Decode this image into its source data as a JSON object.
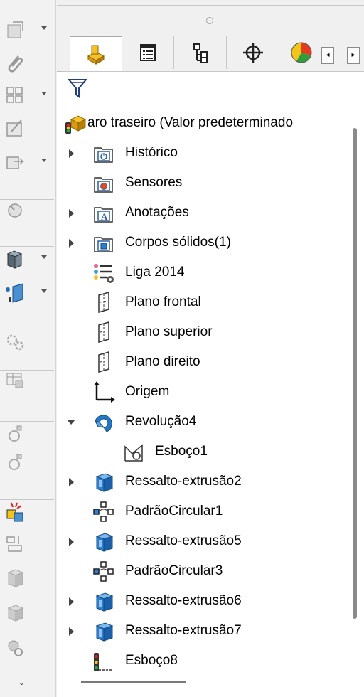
{
  "toolbar": {
    "buttons": [
      {
        "icon": "new-sketch-icon",
        "dropdown": true
      },
      {
        "icon": "paperclip-icon",
        "dropdown": false
      },
      {
        "icon": "grid-layout-icon",
        "dropdown": true
      },
      {
        "icon": "edit-sketch-icon",
        "dropdown": false
      },
      {
        "icon": "relations-icon",
        "dropdown": true
      },
      {
        "icon": "rebuild-icon",
        "dropdown": false
      },
      {
        "icon": "extrude-boss-icon",
        "dropdown": true
      },
      {
        "icon": "reference-plane-icon",
        "dropdown": true
      },
      {
        "icon": "gears-icon",
        "dropdown": false
      },
      {
        "icon": "table-icon",
        "dropdown": false
      },
      {
        "icon": "mate-icon",
        "dropdown": false
      },
      {
        "icon": "mate-alt-icon",
        "dropdown": false
      },
      {
        "icon": "explode-icon",
        "dropdown": false
      },
      {
        "icon": "align-icon",
        "dropdown": false
      },
      {
        "icon": "component-icon",
        "dropdown": false
      },
      {
        "icon": "assembly-icon",
        "dropdown": false
      },
      {
        "icon": "camera-icon",
        "dropdown": false
      }
    ],
    "more_label": "ˇ"
  },
  "tabs": [
    {
      "icon": "feature-manager-icon",
      "active": true
    },
    {
      "icon": "property-manager-icon",
      "active": false
    },
    {
      "icon": "configuration-manager-icon",
      "active": false
    },
    {
      "icon": "dimxpert-icon",
      "active": false
    },
    {
      "icon": "display-manager-icon",
      "active": false
    }
  ],
  "tab_scroll": {
    "left": "◂",
    "right": "▸"
  },
  "filter": {
    "icon": "filter-icon"
  },
  "tree": {
    "root": {
      "label": "aro traseiro  (Valor predeterminado",
      "icon": "part-icon"
    },
    "items": [
      {
        "label": "Histórico",
        "icon": "history-folder-icon",
        "expander": "right",
        "indent": 0
      },
      {
        "label": "Sensores",
        "icon": "sensors-folder-icon",
        "expander": "",
        "indent": 0
      },
      {
        "label": "Anotações",
        "icon": "annotations-folder-icon",
        "expander": "right",
        "indent": 0
      },
      {
        "label": "Corpos sólidos(1)",
        "icon": "solid-bodies-folder-icon",
        "expander": "right",
        "indent": 0
      },
      {
        "label": "Liga 2014",
        "icon": "material-icon",
        "expander": "",
        "indent": 0
      },
      {
        "label": "Plano frontal",
        "icon": "plane-icon",
        "expander": "",
        "indent": 0
      },
      {
        "label": "Plano superior",
        "icon": "plane-icon",
        "expander": "",
        "indent": 0
      },
      {
        "label": "Plano direito",
        "icon": "plane-icon",
        "expander": "",
        "indent": 0
      },
      {
        "label": "Origem",
        "icon": "origin-icon",
        "expander": "",
        "indent": 0
      },
      {
        "label": "Revolução4",
        "icon": "revolve-icon",
        "expander": "down",
        "indent": 0
      },
      {
        "label": "Esboço1",
        "icon": "sketch-icon",
        "expander": "",
        "indent": 1
      },
      {
        "label": "Ressalto-extrusão2",
        "icon": "extrude-icon",
        "expander": "right",
        "indent": 0
      },
      {
        "label": "PadrãoCircular1",
        "icon": "circular-pattern-icon",
        "expander": "",
        "indent": 0
      },
      {
        "label": "Ressalto-extrusão5",
        "icon": "extrude-icon",
        "expander": "right",
        "indent": 0
      },
      {
        "label": "PadrãoCircular3",
        "icon": "circular-pattern-icon",
        "expander": "",
        "indent": 0
      },
      {
        "label": "Ressalto-extrusão6",
        "icon": "extrude-icon",
        "expander": "right",
        "indent": 0
      },
      {
        "label": "Ressalto-extrusão7",
        "icon": "extrude-icon",
        "expander": "right",
        "indent": 0
      },
      {
        "label": "Esboço8",
        "icon": "sketch-3d-icon",
        "expander": "",
        "indent": 0
      }
    ]
  },
  "colors": {
    "accent": "#1e6fb8",
    "folder_blue": "#2a5fa0",
    "extrude_blue": "#1c6aa8"
  }
}
